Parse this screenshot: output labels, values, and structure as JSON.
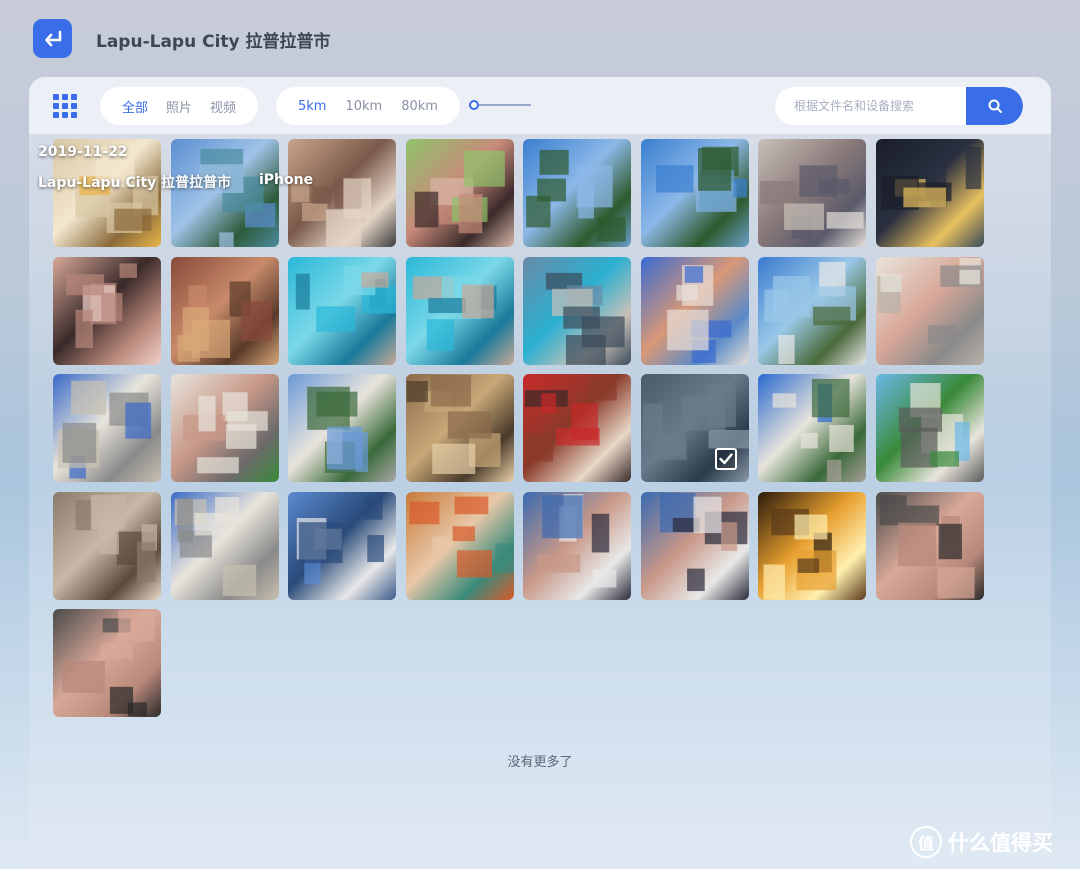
{
  "header": {
    "title": "Lapu-Lapu City 拉普拉普市",
    "back_icon": "return-arrow-icon"
  },
  "toolbar": {
    "view_icon": "grid-icon",
    "type_filter": [
      "全部",
      "照片",
      "视频"
    ],
    "type_active": "全部",
    "distance_filter": [
      "5km",
      "10km",
      "80km"
    ],
    "distance_active": "5km",
    "slider_value": 0,
    "search_placeholder": "根据文件名和设备搜索",
    "search_icon": "search-icon"
  },
  "hover_info": {
    "date": "2019-11-22",
    "place": "Lapu-Lapu City 拉普拉普市",
    "device": "iPhone"
  },
  "photos": [
    {
      "desc": "food plate"
    },
    {
      "desc": "sea view"
    },
    {
      "desc": "person selfie"
    },
    {
      "desc": "two people"
    },
    {
      "desc": "coast"
    },
    {
      "desc": "coast"
    },
    {
      "desc": "person room"
    },
    {
      "desc": "night city"
    },
    {
      "desc": "face"
    },
    {
      "desc": "group meal"
    },
    {
      "desc": "pool"
    },
    {
      "desc": "pool"
    },
    {
      "desc": "pool building"
    },
    {
      "desc": "child"
    },
    {
      "desc": "monument"
    },
    {
      "desc": "church person"
    },
    {
      "desc": "church"
    },
    {
      "desc": "person church"
    },
    {
      "desc": "city hall"
    },
    {
      "desc": "shrine"
    },
    {
      "desc": "candles"
    },
    {
      "desc": "plaza",
      "selected": true
    },
    {
      "desc": "courtyard"
    },
    {
      "desc": "garden"
    },
    {
      "desc": "corridor"
    },
    {
      "desc": "church"
    },
    {
      "desc": "port"
    },
    {
      "desc": "child toy"
    },
    {
      "desc": "group"
    },
    {
      "desc": "group"
    },
    {
      "desc": "sunset"
    },
    {
      "desc": "two faces"
    },
    {
      "desc": "two faces"
    }
  ],
  "footer": {
    "no_more": "没有更多了"
  },
  "watermark": {
    "icon_text": "值",
    "text": "什么值得买"
  }
}
